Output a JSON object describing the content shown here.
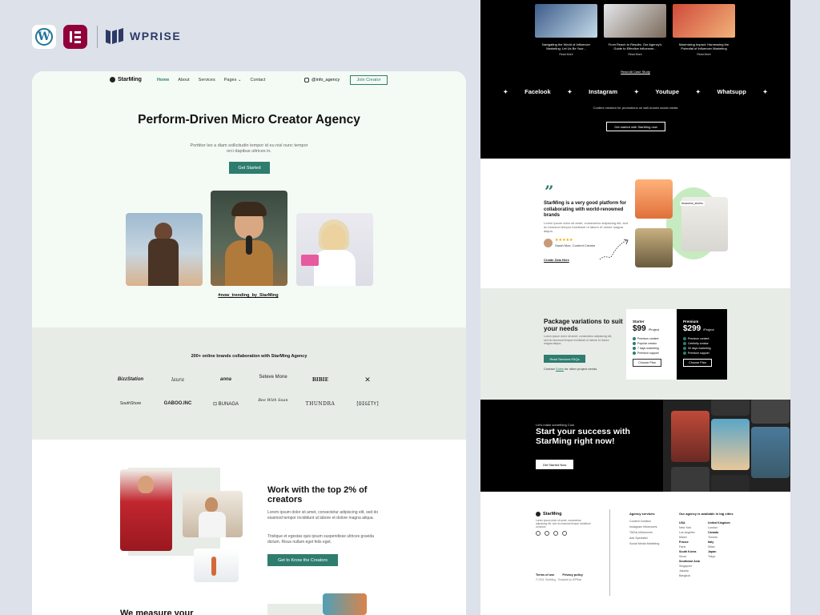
{
  "brandbar": {
    "wprise": "WPRISE",
    "wp_icon": "wordpress-icon",
    "el_icon": "elementor-icon"
  },
  "left": {
    "nav": {
      "logo": "StarMing",
      "items": [
        "Home",
        "About",
        "Services",
        "Pages ⌄",
        "Contact"
      ],
      "handle": "@info_agency",
      "join": "Join Creator"
    },
    "hero": {
      "title": "Perform-Driven Micro Creator Agency",
      "subtitle": "Porttitor leo a diam sollicitudin tempor id eu nisl nunc tempor orci dapibus ultrices in.",
      "cta": "Get Started",
      "hashtag": "#now_trending_by_StarMing"
    },
    "brands": {
      "title": "200+ online brands collaboration with StarMing Agency",
      "row1": [
        "BizzStation",
        "laura",
        "anna",
        "Seteve Mone",
        "BIBIE",
        "✕"
      ],
      "row2": [
        "SouthShore",
        "GABOO.INC",
        "⊡ BUNAGA",
        "Bee With Sean",
        "THUNDRA",
        "[DIGITY]"
      ]
    },
    "work": {
      "title": "Work with the top 2% of creators",
      "body1": "Lorem ipsum dolor sit amet, consectetur adipiscing elit, sed do eiusmod tempor incididunt ut labore et dolore magna aliqua.",
      "body2": "Tristique et egestas quis ipsum suspendisse ultrices gravida dictum. Risus nullam eget felis eget.",
      "cta": "Get to Know the Creators"
    },
    "measure": "We measure your"
  },
  "right": {
    "cases": [
      {
        "caption": "Navigating the World of Influencer Marketing: Let Us Be Your...",
        "more": "Read More"
      },
      {
        "caption": "From Reach to Results: Our Agency's Guide to Effective Influencer...",
        "more": "Read More"
      },
      {
        "caption": "Maximizing Impact: Harnessing the Potential of Influencer Marketing",
        "more": "Read More"
      }
    ],
    "read_all": "Read All Case Study",
    "socials": [
      "Facelook",
      "Instagram",
      "Youtupe",
      "Whatsupp"
    ],
    "content_line": "Content creation for promotions on well-known social media",
    "started_now": "Get started with StarMing now",
    "testimonial": {
      "quote": "StarMing is a very good platform for collaborating with world-renowned brands",
      "body": "Lorem ipsum dolor sit amet, consectetur adipiscing elit, sed do eiusmod tempor incididunt ut labore et dolore magna aliqua.",
      "stars": "★★★★★",
      "author": "Sarah Moe, Content Creator",
      "link": "Create Zola Here",
      "tag": "#success_stories"
    },
    "packages": {
      "title": "Package variations to suit your needs",
      "body": "Lorem ipsum dolor sit amet, consectetur adipiscing elit, sed do eiusmod tempor incididunt ut labore et dolore magna aliqua.",
      "btn": "Read Services FAQs",
      "link_pre": "Contact",
      "link": "Sales",
      "link_post": "for other project needs.",
      "starter": {
        "name": "Starter",
        "price": "$99",
        "unit": "/Project",
        "features": [
          "Premium content",
          "Popular creator",
          "7 days marketing",
          "Premium support"
        ],
        "btn": "Choose Plan"
      },
      "premium": {
        "name": "Premium",
        "price": "$299",
        "unit": "/Project",
        "features": [
          "Premium content",
          "Celebrity creator",
          "30 days marketing",
          "Premium support"
        ],
        "btn": "Choose Plan"
      }
    },
    "cta": {
      "pre": "Let's make something Cool",
      "title": "Start your success with StarMing right now!",
      "btn": "Get Started Now"
    },
    "footer": {
      "logo": "StarMing",
      "desc": "Lorem ipsum dolor sit amet, consectetur adipiscing elit, sed do eiusmod tempor incididunt ut labore.",
      "services_head": "Agency services",
      "services": [
        "Content Creation",
        "Instagram Influencers",
        "TikTok Influencers",
        "Ads Specialist",
        "Social Media Marketing"
      ],
      "avail_head": "Our agency is available in big cities",
      "countries_a": [
        {
          "c": "USA",
          "cities": [
            "New York",
            "Los Angeles",
            "Miami"
          ]
        },
        {
          "c": "France",
          "cities": [
            "Paris"
          ]
        },
        {
          "c": "South Korea",
          "cities": [
            "Seoul"
          ]
        },
        {
          "c": "Southeast Asia",
          "cities": [
            "Singapore",
            "Jakarta",
            "Bangkok"
          ]
        }
      ],
      "countries_b": [
        {
          "c": "United Kingdom",
          "cities": [
            "London"
          ]
        },
        {
          "c": "Canada",
          "cities": [
            "Toronto"
          ]
        },
        {
          "c": "Italy",
          "cities": [
            "Milan"
          ]
        },
        {
          "c": "Japan",
          "cities": [
            "Tokyo"
          ]
        }
      ],
      "terms": "Terms of use",
      "privacy": "Privacy policy",
      "copy": "© 2024, StarMing - Template by WPRise"
    }
  },
  "colors": {
    "accent": "#2e7d6f",
    "mint": "#e8ece7",
    "black": "#000000"
  }
}
